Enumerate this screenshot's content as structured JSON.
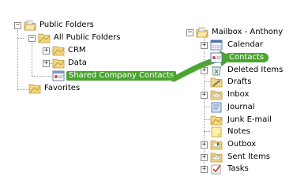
{
  "left_tree": {
    "root": {
      "label": "Public Folders",
      "expander": "−"
    },
    "all_public": {
      "label": "All Public Folders",
      "expander": "−"
    },
    "crm": {
      "label": "CRM",
      "expander": "+"
    },
    "data": {
      "label": "Data",
      "expander": "+"
    },
    "shared": {
      "label": "Shared Company Contacts"
    },
    "favorites": {
      "label": "Favorites"
    }
  },
  "right_tree": {
    "root": {
      "label": "Mailbox - Anthony",
      "expander": "−"
    },
    "items": [
      {
        "label": "Calendar",
        "icon": "calendar-icon",
        "expander": "+"
      },
      {
        "label": "Contacts",
        "icon": "contacts-icon",
        "expander": ""
      },
      {
        "label": "Deleted Items",
        "icon": "deleted-items-icon",
        "expander": "+"
      },
      {
        "label": "Drafts",
        "icon": "drafts-icon",
        "expander": ""
      },
      {
        "label": "Inbox",
        "icon": "inbox-icon",
        "expander": "+"
      },
      {
        "label": "Journal",
        "icon": "journal-icon",
        "expander": ""
      },
      {
        "label": "Junk E-mail",
        "icon": "junk-email-icon",
        "expander": ""
      },
      {
        "label": "Notes",
        "icon": "notes-icon",
        "expander": ""
      },
      {
        "label": "Outbox",
        "icon": "outbox-icon",
        "expander": "+"
      },
      {
        "label": "Sent Items",
        "icon": "sent-items-icon",
        "expander": "+"
      },
      {
        "label": "Tasks",
        "icon": "tasks-icon",
        "expander": "+"
      }
    ]
  },
  "colors": {
    "highlight": "#4aa531",
    "folder": "#f3d680",
    "arrow": "#4aa531"
  }
}
